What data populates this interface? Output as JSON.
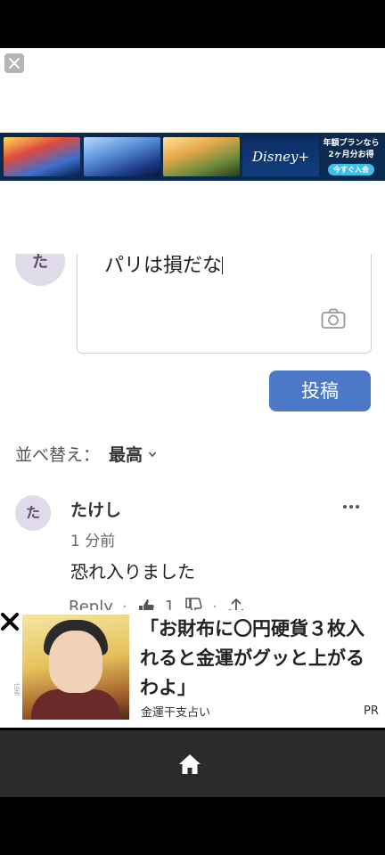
{
  "banner": {
    "promo_line1": "年額プランなら",
    "promo_line2": "2ヶ月分お得",
    "promo_button": "今すぐ入会",
    "brand": "Disney+"
  },
  "composer": {
    "text": "パリは損だな"
  },
  "post_button": "投稿",
  "sort": {
    "label": "並べ替え：",
    "value": "最高"
  },
  "comment": {
    "avatar_initial": "た",
    "username": "たけし",
    "time": "1 分前",
    "text": "恐れ入りました",
    "reply_label": "Reply",
    "like_count": "1"
  },
  "top_avatar_initial": "た",
  "ad": {
    "headline": "「お財布に〇円硬貨３枚入れると金運がグッと上がるわよ」",
    "source": "金運干支占い",
    "pr": "PR",
    "side_label": "広告"
  },
  "colors": {
    "post_button": "#4b79c8",
    "avatar_bg": "#e0dbe8",
    "nav_bar": "#2b2b2b"
  }
}
